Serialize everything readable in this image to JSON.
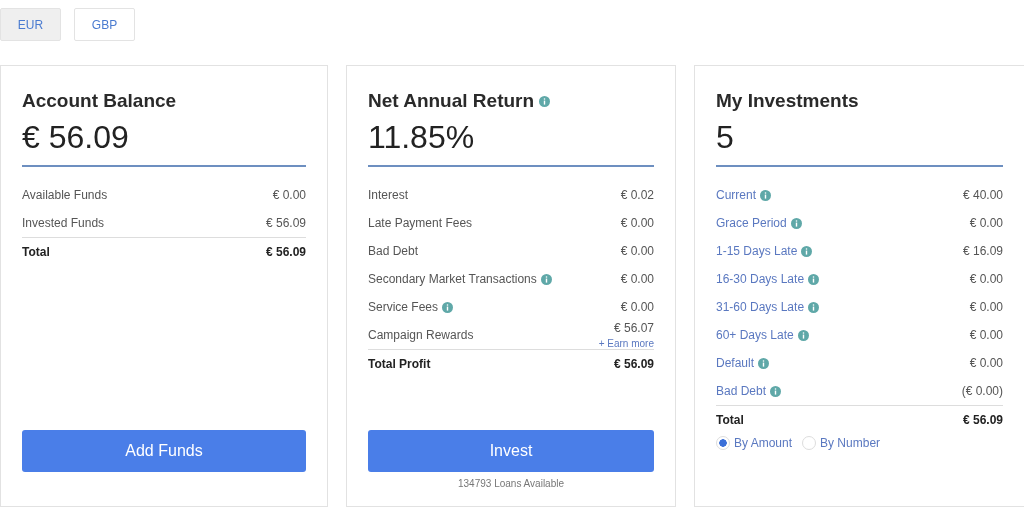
{
  "currencies": [
    {
      "label": "EUR",
      "selected": true
    },
    {
      "label": "GBP",
      "selected": false
    }
  ],
  "cards": [
    {
      "title": "Account Balance",
      "title_info": false,
      "value": "€ 56.09",
      "rows": [
        {
          "kind": "plain",
          "label": "Available Funds",
          "value": "€ 0.00",
          "info": false
        },
        {
          "kind": "plain",
          "label": "Invested Funds",
          "value": "€ 56.09",
          "info": false
        }
      ],
      "total": {
        "label": "Total",
        "value": "€ 56.09"
      },
      "button": "Add Funds"
    },
    {
      "title": "Net Annual Return",
      "title_info": true,
      "value": "11.85%",
      "rows": [
        {
          "kind": "plain",
          "label": "Interest",
          "value": "€ 0.02",
          "info": false
        },
        {
          "kind": "plain",
          "label": "Late Payment Fees",
          "value": "€ 0.00",
          "info": false
        },
        {
          "kind": "plain",
          "label": "Bad Debt",
          "value": "€ 0.00",
          "info": false
        },
        {
          "kind": "plain",
          "label": "Secondary Market Transactions",
          "value": "€ 0.00",
          "info": true
        },
        {
          "kind": "plain",
          "label": "Service Fees",
          "value": "€ 0.00",
          "info": true
        },
        {
          "kind": "plain",
          "label": "Campaign Rewards",
          "value": "€ 56.07",
          "info": false,
          "link": "+ Earn more"
        }
      ],
      "total": {
        "label": "Total Profit",
        "value": "€ 56.09"
      },
      "button": "Invest",
      "footnote": "134793 Loans Available"
    },
    {
      "title": "My Investments",
      "title_info": false,
      "value": "5",
      "rows": [
        {
          "kind": "link",
          "label": "Current",
          "value": "€ 40.00",
          "info": true
        },
        {
          "kind": "link",
          "label": "Grace Period",
          "value": "€ 0.00",
          "info": true
        },
        {
          "kind": "link",
          "label": "1-15 Days Late",
          "value": "€ 16.09",
          "info": true
        },
        {
          "kind": "link",
          "label": "16-30 Days Late",
          "value": "€ 0.00",
          "info": true
        },
        {
          "kind": "link",
          "label": "31-60 Days Late",
          "value": "€ 0.00",
          "info": true
        },
        {
          "kind": "link",
          "label": "60+ Days Late",
          "value": "€ 0.00",
          "info": true
        },
        {
          "kind": "link",
          "label": "Default",
          "value": "€ 0.00",
          "info": true
        },
        {
          "kind": "link",
          "label": "Bad Debt",
          "value": "(€ 0.00)",
          "info": true
        }
      ],
      "total": {
        "label": "Total",
        "value": "€ 56.09"
      },
      "radios": [
        {
          "label": "By Amount",
          "selected": true
        },
        {
          "label": "By Number",
          "selected": false
        }
      ]
    }
  ]
}
